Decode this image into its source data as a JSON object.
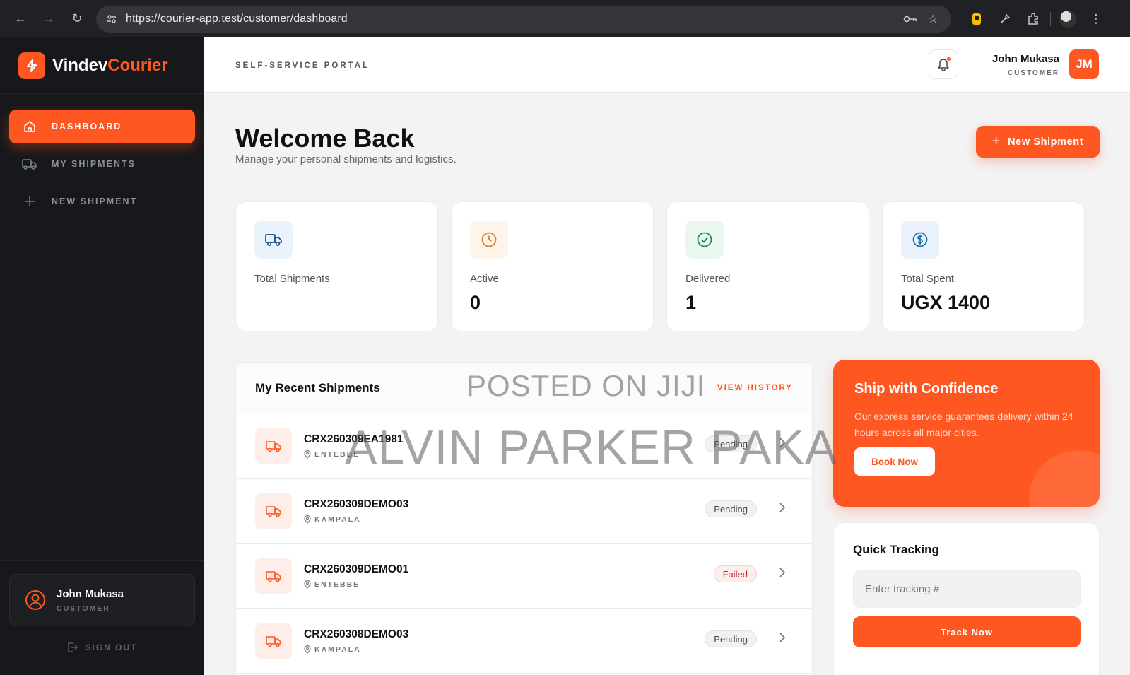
{
  "browser": {
    "url": "https://courier-app.test/customer/dashboard"
  },
  "brand": {
    "name_main": "Vindev",
    "name_accent": "Courier",
    "accent_color": "#ff5722"
  },
  "sidebar": {
    "items": [
      {
        "label": "DASHBOARD",
        "icon": "home-icon",
        "active": true
      },
      {
        "label": "MY SHIPMENTS",
        "icon": "truck-icon",
        "active": false
      },
      {
        "label": "NEW SHIPMENT",
        "icon": "plus-icon",
        "active": false
      }
    ],
    "user": {
      "name": "John Mukasa",
      "role": "CUSTOMER"
    },
    "signout_label": "SIGN OUT"
  },
  "header": {
    "portal_label": "SELF-SERVICE PORTAL",
    "user_name": "John Mukasa",
    "user_role": "CUSTOMER",
    "avatar_initials": "JM"
  },
  "main": {
    "title": "Welcome Back",
    "subtitle": "Manage your personal shipments and logistics.",
    "new_shipment_label": "New Shipment"
  },
  "stats": [
    {
      "label": "Total Shipments",
      "value": "",
      "icon": "truck-icon",
      "color": "#1d4f8c",
      "bg": "#eaf2fb"
    },
    {
      "label": "Active",
      "value": "0",
      "icon": "clock-icon",
      "color": "#d9822b",
      "bg": "#fdf5e9"
    },
    {
      "label": "Delivered",
      "value": "1",
      "icon": "check-circle-icon",
      "color": "#1f8a4c",
      "bg": "#e9f7ef"
    },
    {
      "label": "Total Spent",
      "value": "UGX 1400",
      "icon": "dollar-icon",
      "color": "#1d6fa8",
      "bg": "#eaf3fb"
    }
  ],
  "recent": {
    "title": "My Recent Shipments",
    "view_history_label": "VIEW HISTORY",
    "rows": [
      {
        "id": "CRX260309EA1981",
        "location": "ENTEBBE",
        "status": "Pending"
      },
      {
        "id": "CRX260309DEMO03",
        "location": "KAMPALA",
        "status": "Pending"
      },
      {
        "id": "CRX260309DEMO01",
        "location": "ENTEBBE",
        "status": "Failed"
      },
      {
        "id": "CRX260308DEMO03",
        "location": "KAMPALA",
        "status": "Pending"
      }
    ]
  },
  "promo": {
    "title": "Ship with Confidence",
    "description": "Our express service guarantees delivery within 24 hours across all major cities.",
    "button_label": "Book Now"
  },
  "tracking": {
    "title": "Quick Tracking",
    "placeholder": "Enter tracking #",
    "value": "",
    "button_label": "Track Now"
  },
  "watermark": {
    "line1": "POSTED ON JIJI",
    "line2": "ALVIN PARKER PAKA"
  }
}
